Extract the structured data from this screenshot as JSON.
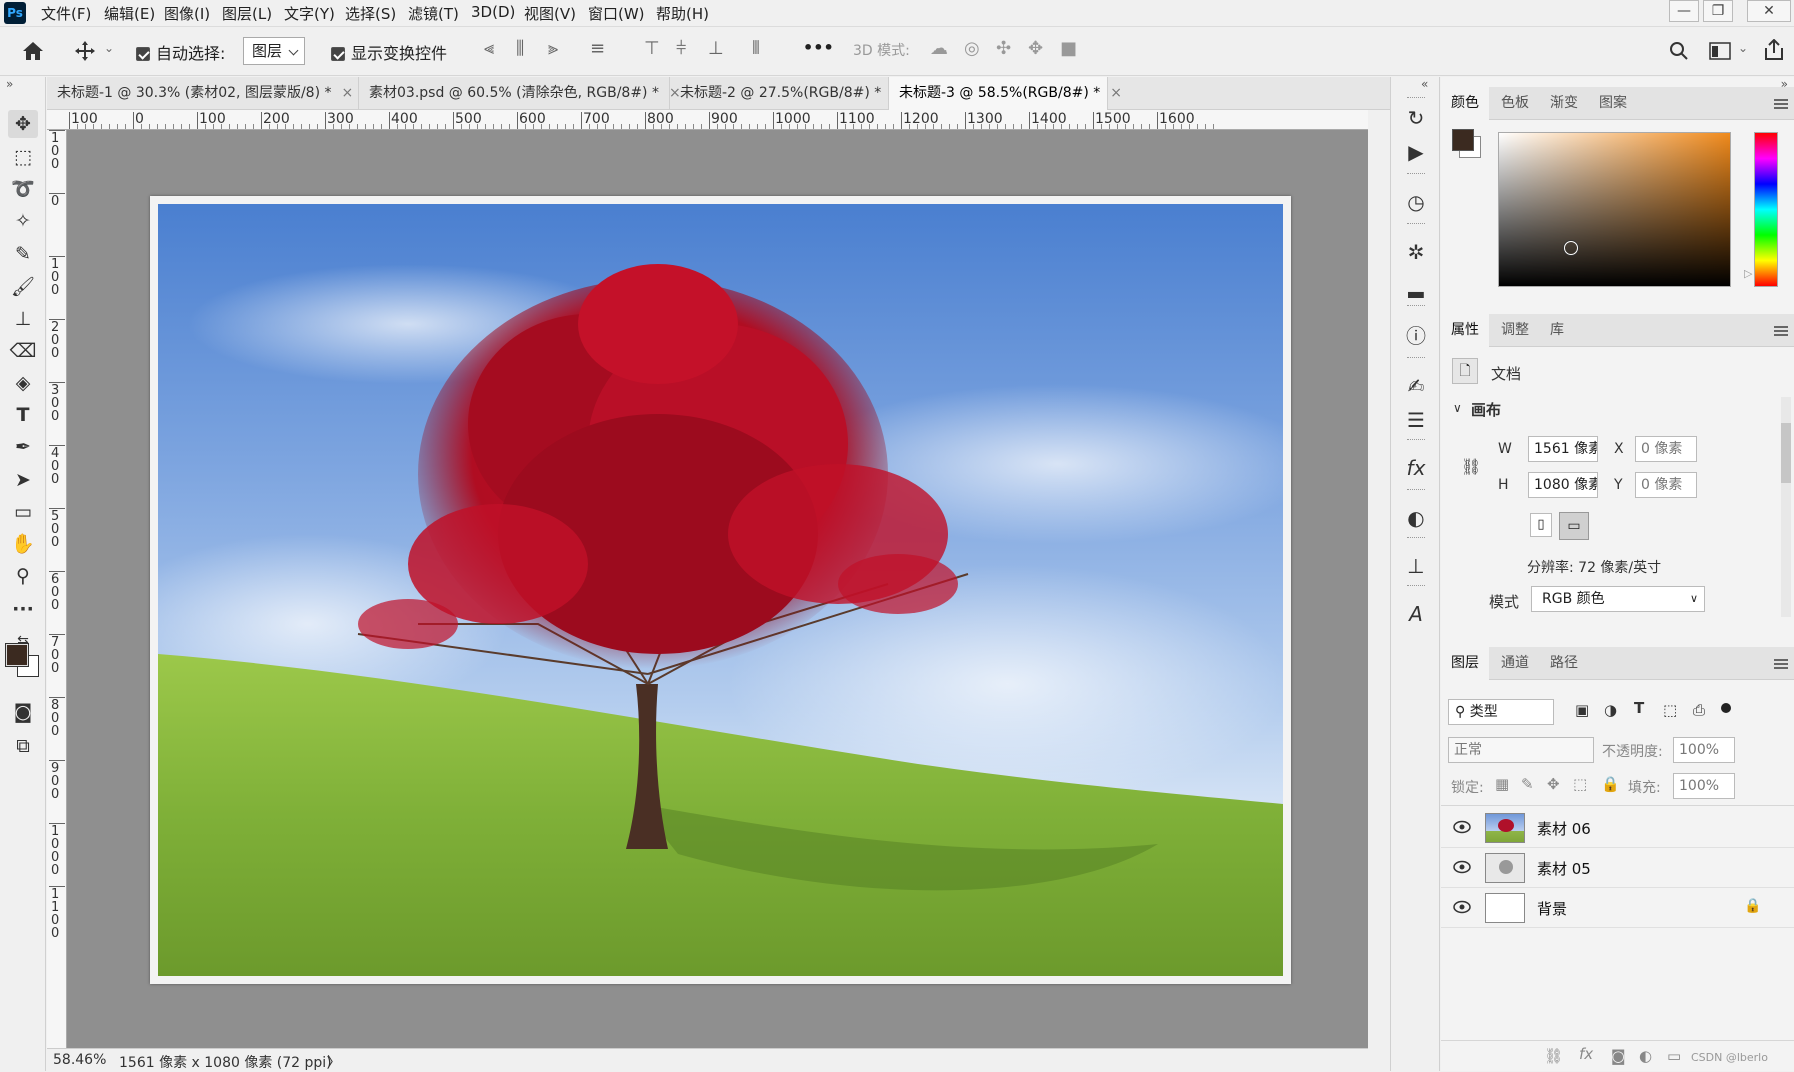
{
  "app": {
    "logo": "Ps"
  },
  "menu": [
    "文件(F)",
    "编辑(E)",
    "图像(I)",
    "图层(L)",
    "文字(Y)",
    "选择(S)",
    "滤镜(T)",
    "3D(D)",
    "视图(V)",
    "窗口(W)",
    "帮助(H)"
  ],
  "window_buttons": [
    "—",
    "❐",
    "✕"
  ],
  "options": {
    "home_icon": "home-icon",
    "move_icon": "move-icon",
    "auto_select_label": "自动选择:",
    "auto_select_value": "图层",
    "show_transform_label": "显示变换控件",
    "more_label": "•••",
    "mode3d_label": "3D 模式:"
  },
  "tools": [
    "move",
    "marquee",
    "lasso",
    "magic-wand",
    "spot-heal",
    "brush",
    "stamp",
    "eraser",
    "paint-bucket",
    "type",
    "pen",
    "path-select",
    "shape",
    "hand",
    "zoom",
    "more",
    "swap",
    "fg-color",
    "quick-mask",
    "screen-mode"
  ],
  "tabs": [
    {
      "label": "未标题-1 @ 30.3% (素材02, 图层蒙版/8) *",
      "close": "×"
    },
    {
      "label": "素材03.psd @ 60.5% (清除杂色, RGB/8#) *",
      "close": "×"
    },
    {
      "label": "未标题-2 @ 27.5%(RGB/8#) *",
      "close": "×"
    },
    {
      "label": "未标题-3 @ 58.5%(RGB/8#) *",
      "close": "×"
    }
  ],
  "ruler_h": [
    "100",
    "0",
    "100",
    "200",
    "300",
    "400",
    "500",
    "600",
    "700",
    "800",
    "900",
    "1000",
    "1100",
    "1200",
    "1300",
    "1400",
    "1500",
    "1600"
  ],
  "ruler_v": [
    "1 0 0",
    "0",
    "1 0 0",
    "2 0 0",
    "3 0 0",
    "4 0 0",
    "5 0 0",
    "6 0 0",
    "7 0 0",
    "8 0 0",
    "9 0 0",
    "1 0 0 0",
    "1 1 0 0"
  ],
  "status": {
    "zoom": "58.46%",
    "info": "1561 像素 x 1080 像素 (72 ppi)",
    "arrow": "〉"
  },
  "color_panel": {
    "tabs": [
      "颜色",
      "色板",
      "渐变",
      "图案"
    ],
    "fg": "#3b2a20",
    "bg": "#ffffff",
    "hue": "#f08a1c"
  },
  "properties_panel": {
    "tabs": [
      "属性",
      "调整",
      "库"
    ],
    "doc_label": "文档",
    "section": "画布",
    "w_label": "W",
    "w_value": "1561 像素",
    "h_label": "H",
    "h_value": "1080 像素",
    "x_label": "X",
    "x_value": "0 像素",
    "y_label": "Y",
    "y_value": "0 像素",
    "resolution": "分辨率: 72 像素/英寸",
    "mode_label": "模式",
    "mode_value": "RGB 颜色"
  },
  "layers_panel": {
    "tabs": [
      "图层",
      "通道",
      "路径"
    ],
    "filter_value": "类型",
    "blend_value": "正常",
    "opacity_label": "不透明度:",
    "opacity_value": "100%",
    "lock_label": "锁定:",
    "fill_label": "填充:",
    "fill_value": "100%",
    "layers": [
      {
        "name": "素材 06",
        "thumb": "tree-photo"
      },
      {
        "name": "素材 05",
        "thumb": "tree-sketch"
      },
      {
        "name": "背景",
        "thumb": "white",
        "locked": true
      }
    ],
    "watermark": "CSDN @lberlo"
  }
}
